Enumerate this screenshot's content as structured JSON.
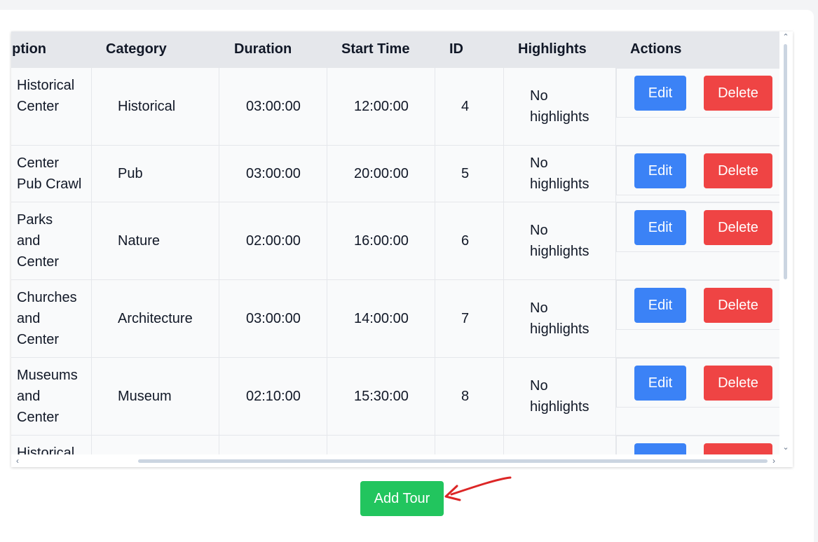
{
  "table": {
    "columns": [
      "Description",
      "Category",
      "Duration",
      "Start Time",
      "ID",
      "Highlights",
      "Actions"
    ],
    "rows": [
      {
        "description": [
          "Historical",
          "Center"
        ],
        "category": "Historical",
        "duration": "03:00:00",
        "start_time": "12:00:00",
        "id": "4",
        "highlights": [
          "No",
          "highlights"
        ]
      },
      {
        "description": [
          "Center",
          "Pub Crawl"
        ],
        "category": "Pub",
        "duration": "03:00:00",
        "start_time": "20:00:00",
        "id": "5",
        "highlights": [
          "No",
          "highlights"
        ]
      },
      {
        "description": [
          "Parks",
          "and",
          "Center"
        ],
        "category": "Nature",
        "duration": "02:00:00",
        "start_time": "16:00:00",
        "id": "6",
        "highlights": [
          "No",
          "highlights"
        ]
      },
      {
        "description": [
          "Churches",
          "and",
          "Center"
        ],
        "category": "Architecture",
        "duration": "03:00:00",
        "start_time": "14:00:00",
        "id": "7",
        "highlights": [
          "No",
          "highlights"
        ]
      },
      {
        "description": [
          "Museums",
          "and",
          "Center"
        ],
        "category": "Museum",
        "duration": "02:10:00",
        "start_time": "15:30:00",
        "id": "8",
        "highlights": [
          "No",
          "highlights"
        ]
      },
      {
        "description": [
          "Historical"
        ],
        "category": "",
        "duration": "",
        "start_time": "",
        "id": "",
        "highlights": []
      }
    ],
    "edit_label": "Edit",
    "delete_label": "Delete"
  },
  "add_tour_label": "Add Tour",
  "colors": {
    "edit": "#3b82f6",
    "delete": "#ef4444",
    "add": "#22c55e",
    "header_bg": "#e5e7eb",
    "annotation_arrow": "#dc2626"
  }
}
